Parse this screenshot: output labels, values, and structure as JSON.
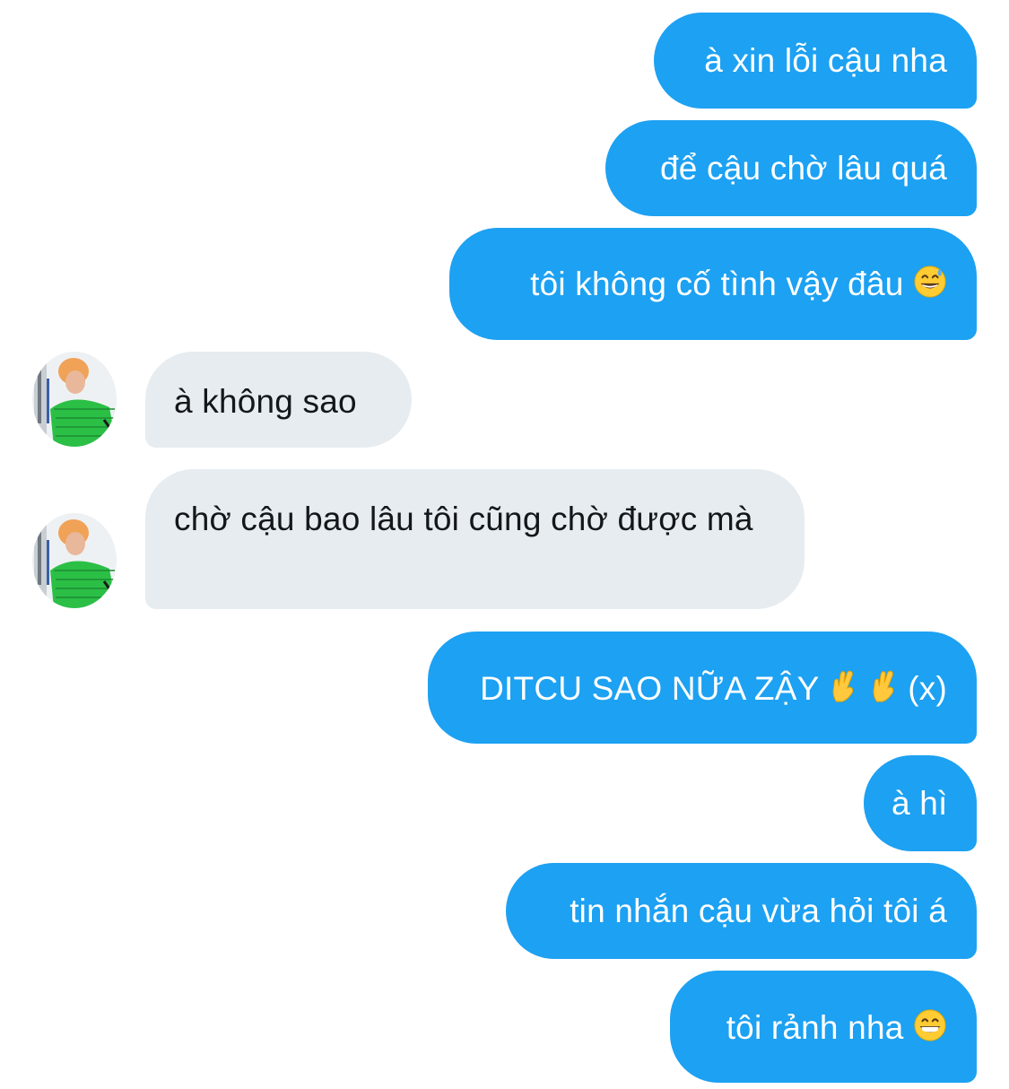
{
  "conversation": {
    "messages": [
      {
        "side": "out",
        "text": "à xin lỗi cậu nha"
      },
      {
        "side": "out",
        "text": "để cậu chờ lâu quá"
      },
      {
        "side": "out",
        "text": "tôi không cố tình vậy đâu",
        "emoji": "grinning-sweat-face-icon"
      },
      {
        "side": "in",
        "text": "à không sao"
      },
      {
        "side": "in",
        "text": "chờ cậu bao lâu tôi cũng chờ được mà"
      },
      {
        "side": "out",
        "text": "DITCU SAO NỮA ZẬY",
        "suffix": "(x)",
        "emoji": "crossed-fingers-icon"
      },
      {
        "side": "out",
        "text": "à hì"
      },
      {
        "side": "out",
        "text": "tin nhắn cậu vừa hỏi tôi á"
      },
      {
        "side": "out",
        "text": "tôi rảnh nha",
        "emoji": "beaming-face-icon"
      }
    ]
  },
  "colors": {
    "outgoing_bubble": "#1da1f2",
    "incoming_bubble": "#e6ecf0",
    "incoming_text": "#14171a",
    "outgoing_text": "#ffffff"
  }
}
